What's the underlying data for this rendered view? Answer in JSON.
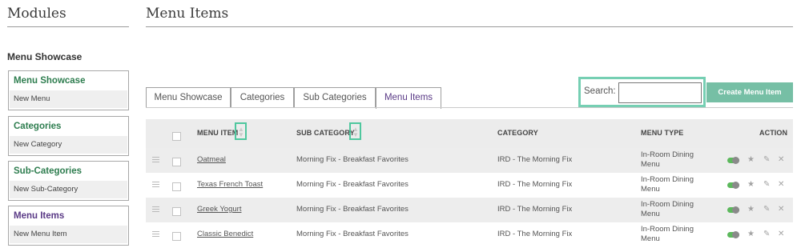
{
  "sidebar": {
    "title": "Modules",
    "subtitle": "Menu Showcase",
    "modules": [
      {
        "heading": "Menu Showcase",
        "link": "New Menu"
      },
      {
        "heading": "Categories",
        "link": "New Category"
      },
      {
        "heading": "Sub-Categories",
        "link": "New Sub-Category"
      },
      {
        "heading": "Menu Items",
        "link": "New Menu Item"
      }
    ]
  },
  "main": {
    "title": "Menu Items",
    "tabs": [
      {
        "label": "Menu Showcase"
      },
      {
        "label": "Categories"
      },
      {
        "label": "Sub Categories"
      },
      {
        "label": "Menu Items",
        "active": true
      }
    ],
    "search": {
      "label": "Search:",
      "value": "",
      "placeholder": ""
    },
    "create_button": "Create Menu Item",
    "table": {
      "headers": {
        "item": "MENU ITEM",
        "subcategory": "SUB CATEGORY",
        "category": "CATEGORY",
        "type": "MENU TYPE",
        "action": "ACTION"
      },
      "rows": [
        {
          "item": "Oatmeal",
          "subcategory": "Morning Fix - Breakfast Favorites",
          "category": "IRD - The Morning Fix",
          "type_line1": "In-Room Dining",
          "type_line2": "Menu"
        },
        {
          "item": "Texas French Toast",
          "subcategory": "Morning Fix - Breakfast Favorites",
          "category": "IRD - The Morning Fix",
          "type_line1": "In-Room Dining",
          "type_line2": "Menu"
        },
        {
          "item": "Greek Yogurt",
          "subcategory": "Morning Fix - Breakfast Favorites",
          "category": "IRD - The Morning Fix",
          "type_line1": "In-Room Dining",
          "type_line2": "Menu"
        },
        {
          "item": "Classic Benedict",
          "subcategory": "Morning Fix - Breakfast Favorites",
          "category": "IRD - The Morning Fix",
          "type_line1": "In-Room Dining",
          "type_line2": "Menu"
        }
      ]
    }
  },
  "icons": {
    "sort": "sort-icon",
    "drag": "drag-handle-icon",
    "toggle": "toggle-icon",
    "star": "star-icon",
    "edit": "pencil-icon",
    "delete": "close-icon"
  },
  "colors": {
    "accent_green": "#76bfa5",
    "highlight_border": "#76cfb3",
    "heading_green": "#2e7d4f",
    "heading_purple": "#5a3a86",
    "toggle_on": "#5cb85c"
  }
}
